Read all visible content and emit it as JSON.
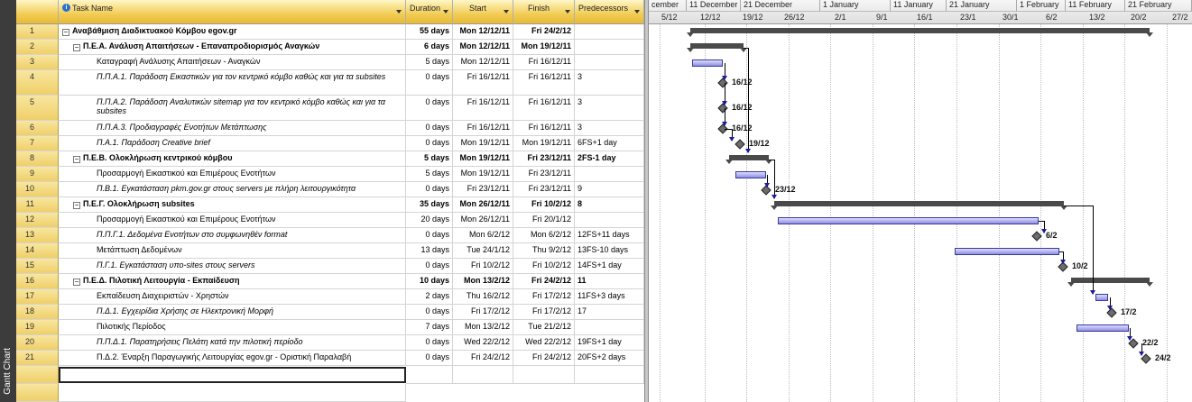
{
  "view_bar": {
    "label": "Gantt Chart"
  },
  "table": {
    "columns": {
      "task_name": "Task Name",
      "duration": "Duration",
      "start": "Start",
      "finish": "Finish",
      "predecessors": "Predecessors"
    },
    "rows": [
      {
        "id": "1",
        "name": "Αναβάθμιση Διαδικτυακού Κόμβου egov.gr",
        "duration": "55 days",
        "start": "Mon 12/12/11",
        "finish": "Fri 24/2/12",
        "pred": "",
        "level": 0,
        "summary": true,
        "italic": false
      },
      {
        "id": "2",
        "name": "Π.Ε.Α. Ανάλυση Απαιτήσεων - Επαναπροδιορισμός Αναγκών",
        "duration": "6 days",
        "start": "Mon 12/12/11",
        "finish": "Mon 19/12/11",
        "pred": "",
        "level": 1,
        "summary": true,
        "italic": false
      },
      {
        "id": "3",
        "name": "Καταγραφή Ανάλυσης Απαιτήσεων  - Αναγκών",
        "duration": "5 days",
        "start": "Mon 12/12/11",
        "finish": "Fri 16/12/11",
        "pred": "",
        "level": 2,
        "summary": false,
        "italic": false
      },
      {
        "id": "4",
        "name": "Π.Π.Α.1. Παράδοση Εικαστικών για τον κεντρικό κόμβο καθώς και για τα subsites",
        "duration": "0 days",
        "start": "Fri 16/12/11",
        "finish": "Fri 16/12/11",
        "pred": "3",
        "level": 2,
        "summary": false,
        "italic": true
      },
      {
        "id": "5",
        "name": "Π.Π.Α.2. Παράδοση Αναλυτικών sitemap για τον κεντρικό κόμβο καθώς και για τα subsites",
        "duration": "0 days",
        "start": "Fri 16/12/11",
        "finish": "Fri 16/12/11",
        "pred": "3",
        "level": 2,
        "summary": false,
        "italic": true
      },
      {
        "id": "6",
        "name": "Π.Π.Α.3. Προδιαγραφές Ενοτήτων Μετάπτωσης",
        "duration": "0 days",
        "start": "Fri 16/12/11",
        "finish": "Fri 16/12/11",
        "pred": "3",
        "level": 2,
        "summary": false,
        "italic": true
      },
      {
        "id": "7",
        "name": "Π.Α.1. Παράδοση Creative brief",
        "duration": "0 days",
        "start": "Mon 19/12/11",
        "finish": "Mon 19/12/11",
        "pred": "6FS+1 day",
        "level": 2,
        "summary": false,
        "italic": true
      },
      {
        "id": "8",
        "name": "Π.Ε.Β. Ολοκλήρωση κεντρικού κόμβου",
        "duration": "5 days",
        "start": "Mon 19/12/11",
        "finish": "Fri 23/12/11",
        "pred": "2FS-1 day",
        "level": 1,
        "summary": true,
        "italic": false
      },
      {
        "id": "9",
        "name": "Προσαρμογή Εικαστικού και Επιμέρους Ενοτήτων",
        "duration": "5 days",
        "start": "Mon 19/12/11",
        "finish": "Fri 23/12/11",
        "pred": "",
        "level": 2,
        "summary": false,
        "italic": false
      },
      {
        "id": "10",
        "name": "Π.Β.1. Εγκατάσταση pkm.gov.gr στους servers με πλήρη λειτουργικότητα",
        "duration": "0 days",
        "start": "Fri 23/12/11",
        "finish": "Fri 23/12/11",
        "pred": "9",
        "level": 2,
        "summary": false,
        "italic": true
      },
      {
        "id": "11",
        "name": "Π.Ε.Γ. Ολοκλήρωση subsites",
        "duration": "35 days",
        "start": "Mon 26/12/11",
        "finish": "Fri 10/2/12",
        "pred": "8",
        "level": 1,
        "summary": true,
        "italic": false
      },
      {
        "id": "12",
        "name": "Προσαρμογή Εικαστικού και Επιμέρους Ενοτήτων",
        "duration": "20 days",
        "start": "Mon 26/12/11",
        "finish": "Fri 20/1/12",
        "pred": "",
        "level": 2,
        "summary": false,
        "italic": false
      },
      {
        "id": "13",
        "name": "Π.Π.Γ.1. Δεδομένα Ενοτήτων στο συμφωνηθέν format",
        "duration": "0 days",
        "start": "Mon 6/2/12",
        "finish": "Mon 6/2/12",
        "pred": "12FS+11 days",
        "level": 2,
        "summary": false,
        "italic": true
      },
      {
        "id": "14",
        "name": "Μετάπτωση Δεδομένων",
        "duration": "13 days",
        "start": "Tue 24/1/12",
        "finish": "Thu 9/2/12",
        "pred": "13FS-10 days",
        "level": 2,
        "summary": false,
        "italic": false
      },
      {
        "id": "15",
        "name": "Π.Γ.1. Εγκατάσταση υπο-sites στους servers",
        "duration": "0 days",
        "start": "Fri 10/2/12",
        "finish": "Fri 10/2/12",
        "pred": "14FS+1 day",
        "level": 2,
        "summary": false,
        "italic": true
      },
      {
        "id": "16",
        "name": "Π.Ε.Δ. Πιλοτική Λειτουργία - Εκπαίδευση",
        "duration": "10 days",
        "start": "Mon 13/2/12",
        "finish": "Fri 24/2/12",
        "pred": "11",
        "level": 1,
        "summary": true,
        "italic": false
      },
      {
        "id": "17",
        "name": "Εκπαίδευση Διαχειριστών - Χρηστών",
        "duration": "2 days",
        "start": "Thu 16/2/12",
        "finish": "Fri 17/2/12",
        "pred": "11FS+3 days",
        "level": 2,
        "summary": false,
        "italic": false
      },
      {
        "id": "18",
        "name": "Π.Δ.1. Εγχειρίδια Χρήσης σε Ηλεκτρονική Μορφή",
        "duration": "0 days",
        "start": "Fri 17/2/12",
        "finish": "Fri 17/2/12",
        "pred": "17",
        "level": 2,
        "summary": false,
        "italic": true
      },
      {
        "id": "19",
        "name": "Πιλοτικής Περίοδος",
        "duration": "7 days",
        "start": "Mon 13/2/12",
        "finish": "Tue 21/2/12",
        "pred": "",
        "level": 2,
        "summary": false,
        "italic": false
      },
      {
        "id": "20",
        "name": "Π.Π.Δ.1. Παρατηρήσεις Πελάτη κατά την πιλοτική περίοδο",
        "duration": "0 days",
        "start": "Wed 22/2/12",
        "finish": "Wed 22/2/12",
        "pred": "19FS+1 day",
        "level": 2,
        "summary": false,
        "italic": true
      },
      {
        "id": "21",
        "name": "Π.Δ.2. Έναρξη Παραγωγικής Λειτουργίας egov.gr - Οριστική Παραλαβή",
        "duration": "0 days",
        "start": "Fri 24/2/12",
        "finish": "Fri 24/2/12",
        "pred": "20FS+2 days",
        "level": 2,
        "summary": false,
        "italic": false
      }
    ]
  },
  "timescale": {
    "major": [
      "cember",
      "11 December",
      "21 December",
      "1 January",
      "11 January",
      "21 January",
      "1 February",
      "11 February",
      "21 February"
    ],
    "minor": [
      "5/12",
      "12/12",
      "19/12",
      "26/12",
      "2/1",
      "9/1",
      "16/1",
      "23/1",
      "30/1",
      "6/2",
      "13/2",
      "20/2",
      "27/2"
    ]
  },
  "milestone_labels": {
    "4": "16/12",
    "5": "16/12",
    "6": "16/12",
    "7": "19/12",
    "10": "23/12",
    "13": "6/2",
    "15": "10/2",
    "18": "17/2",
    "20": "22/2",
    "21": "24/2"
  },
  "colors": {
    "header_gold": "#f2cd55",
    "task_bar": "#8f8fe0",
    "summary_bar": "#4a4a4a",
    "link_arrow": "#1a1aa0"
  }
}
